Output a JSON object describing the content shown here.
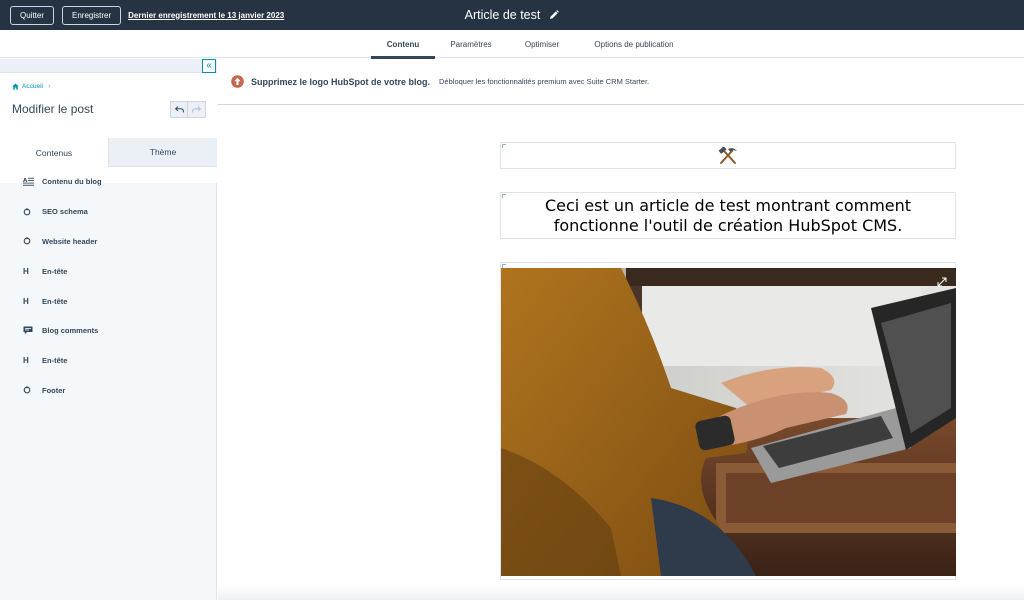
{
  "topbar": {
    "quit_label": "Quitter",
    "save_label": "Enregistrer",
    "last_saved": "Dernier enregistrement le 13 janvier 2023",
    "title": "Article de test",
    "edit_icon": "pencil-icon"
  },
  "tabs": [
    {
      "label": "Contenu",
      "active": true
    },
    {
      "label": "Paramètres",
      "active": false
    },
    {
      "label": "Optimiser",
      "active": false
    },
    {
      "label": "Options de publication",
      "active": false
    }
  ],
  "sidebar": {
    "collapse_icon": "double-chevron-left-icon",
    "breadcrumb": "Accueil",
    "title": "Modifier le post",
    "tabs": [
      {
        "label": "Contenus",
        "active": true
      },
      {
        "label": "Thème",
        "active": false
      }
    ],
    "modules": [
      {
        "label": "Contenu du blog",
        "icon": "rich-text-icon"
      },
      {
        "label": "SEO schema",
        "icon": "module-icon"
      },
      {
        "label": "Website header",
        "icon": "module-icon"
      },
      {
        "label": "En-tête",
        "icon": "heading-icon"
      },
      {
        "label": "En-tête",
        "icon": "heading-icon"
      },
      {
        "label": "Blog comments",
        "icon": "comments-icon"
      },
      {
        "label": "En-tête",
        "icon": "heading-icon"
      },
      {
        "label": "Footer",
        "icon": "module-icon"
      }
    ]
  },
  "banner": {
    "strong": "Supprimez le logo HubSpot de votre blog.",
    "text": "Débloquer les fonctionnalités premium avec Suite CRM Starter.",
    "icon": "upgrade-arrow-icon",
    "accent": "#c2684f"
  },
  "canvas": {
    "logo_icon": "hammer-pick-icon",
    "post_title": "Ceci est un article de test montrant comment fonctionne l'outil de création HubSpot CMS.",
    "image_alt": "laptop-typing-photo",
    "expand_icon": "expand-icon"
  },
  "colors": {
    "topbar": "#253342",
    "text": "#33475b",
    "link": "#0091ae",
    "sidebar_bg": "#f5f8fa"
  }
}
